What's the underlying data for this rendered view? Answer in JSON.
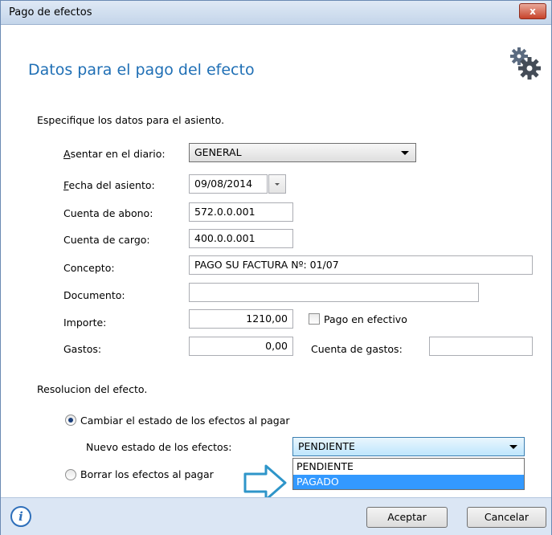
{
  "window": {
    "title": "Pago de efectos",
    "close_label": "x"
  },
  "header": {
    "title": "Datos para el pago del efecto"
  },
  "asiento": {
    "section_label": "Especifique los datos para el asiento.",
    "diario": {
      "label_underline": "A",
      "label_rest": "sentar en el diario:",
      "value": "GENERAL"
    },
    "fecha": {
      "label_underline": "F",
      "label_rest": "echa del asiento:",
      "value": "09/08/2014"
    },
    "cuenta_abono": {
      "label": "Cuenta de abono:",
      "value": "572.0.0.001"
    },
    "cuenta_cargo": {
      "label": "Cuenta de cargo:",
      "value": "400.0.0.001"
    },
    "concepto": {
      "label": "Concepto:",
      "value": "PAGO SU FACTURA Nº:  01/07"
    },
    "documento": {
      "label": "Documento:",
      "value": ""
    },
    "importe": {
      "label": "Importe:",
      "value": "1210,00"
    },
    "pago_efectivo": {
      "label": "Pago en efectivo",
      "checked": false
    },
    "gastos": {
      "label": "Gastos:",
      "value": "0,00"
    },
    "cuenta_gastos": {
      "label": "Cuenta de gastos:",
      "value": ""
    }
  },
  "resolucion": {
    "section_label": "Resolucion del efecto.",
    "cambiar_estado": {
      "label": "Cambiar el estado de los efectos al pagar",
      "checked": true
    },
    "nuevo_estado": {
      "label": "Nuevo estado de los efectos:",
      "value": "PENDIENTE"
    },
    "borrar": {
      "label": "Borrar los efectos al pagar",
      "checked": false
    },
    "options": [
      "PENDIENTE",
      "PAGADO"
    ],
    "highlighted_option": "PAGADO"
  },
  "footer": {
    "info_glyph": "i",
    "accept_label": "Aceptar",
    "cancel_label": "Cancelar"
  },
  "colors": {
    "title_blue": "#1f6fb5",
    "selection_blue": "#3399ff",
    "footer_bg": "#dbe6f4",
    "close_red": "#c7432b"
  },
  "icons": [
    "gear-icon",
    "close-icon",
    "info-icon",
    "arrow-pointer-icon",
    "calendar-dropdown-icon"
  ]
}
